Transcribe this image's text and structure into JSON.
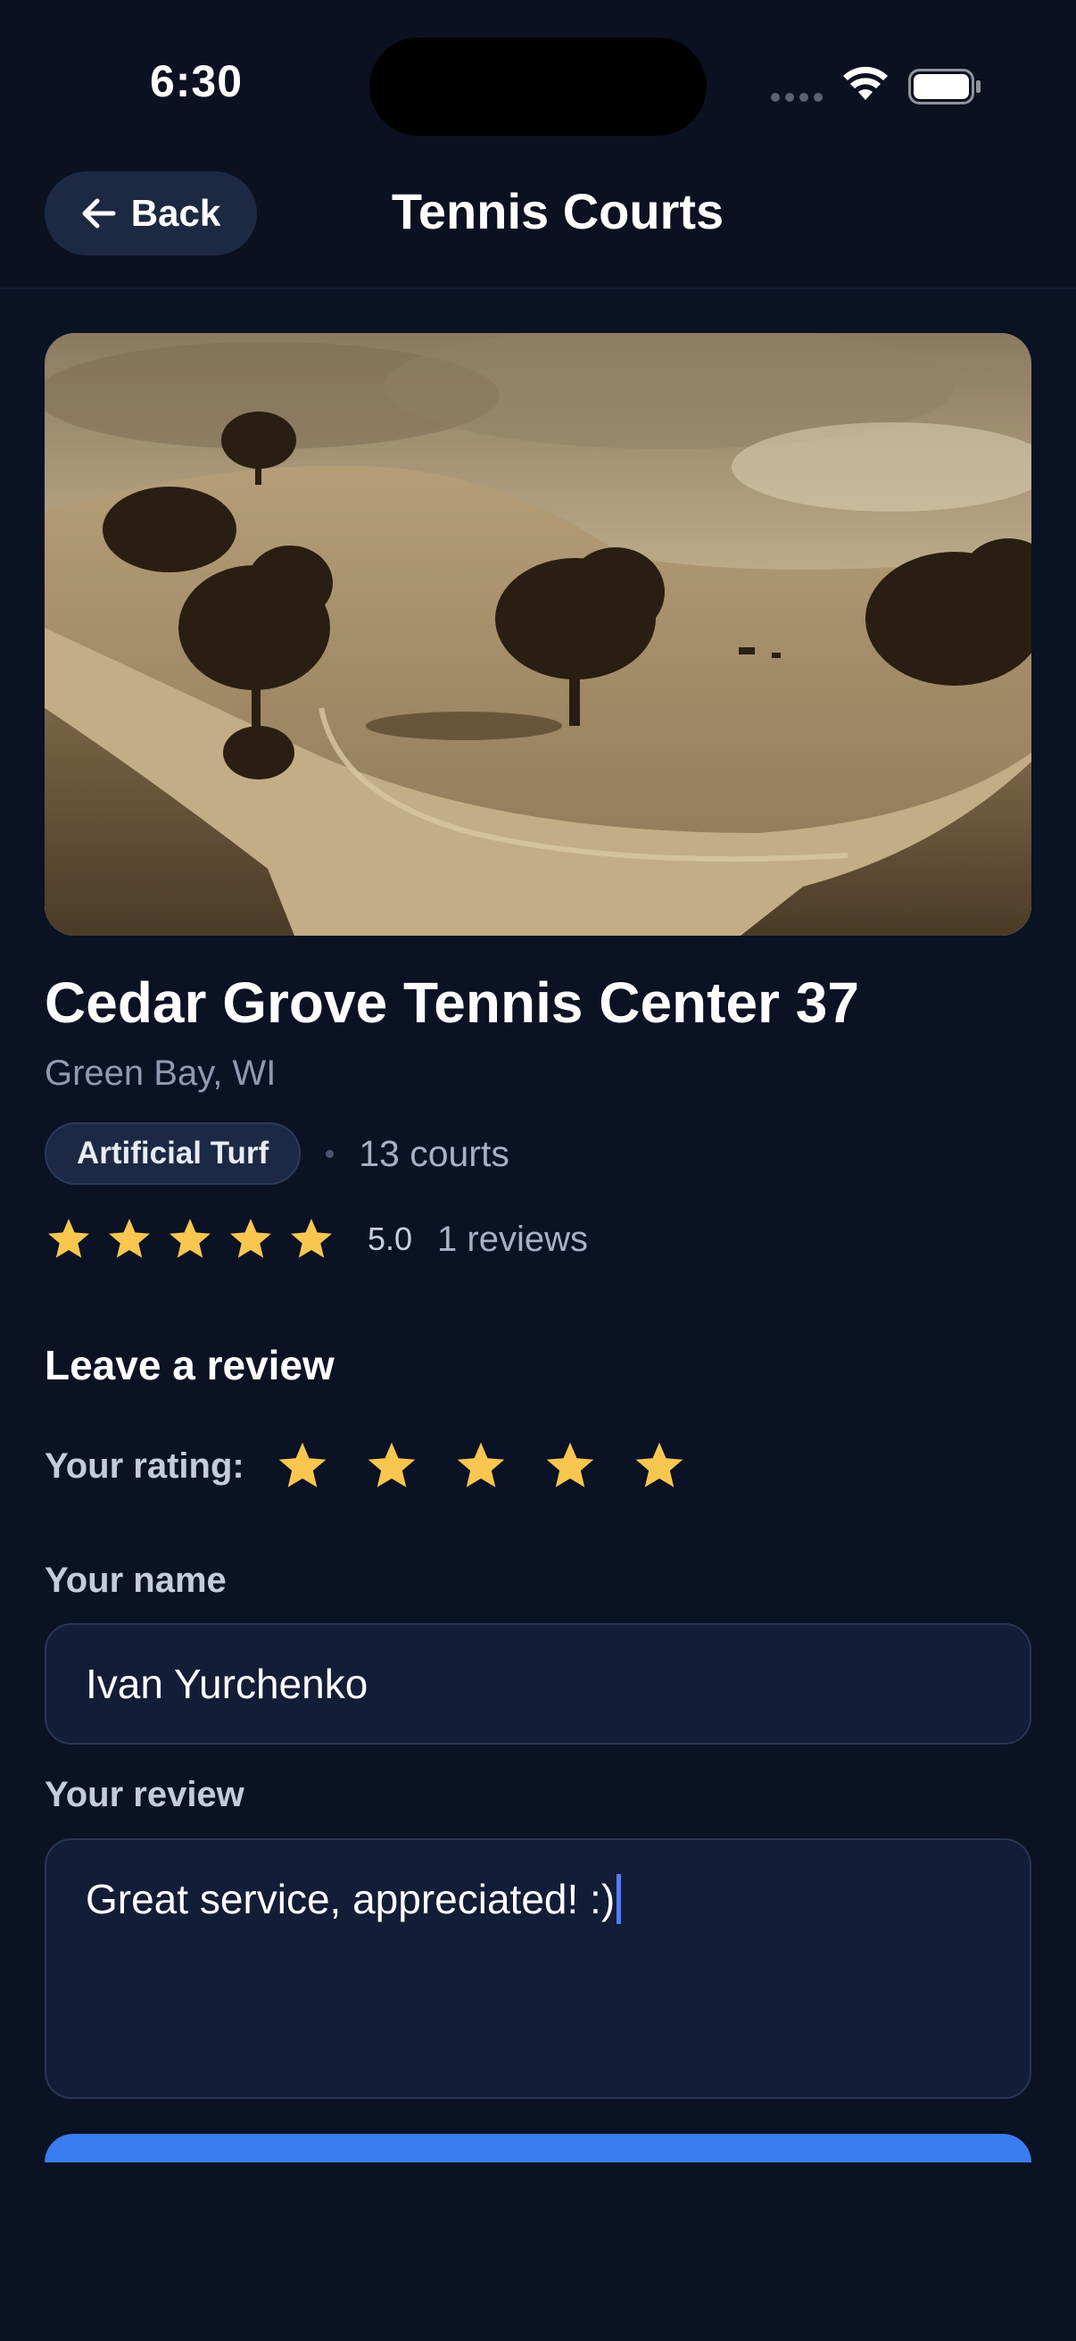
{
  "status_bar": {
    "time": "6:30"
  },
  "nav": {
    "back_label": "Back",
    "title": "Tennis Courts"
  },
  "court": {
    "name": "Cedar Grove Tennis Center 37",
    "location": "Green Bay, WI",
    "surface": "Artificial Turf",
    "courts": "13 courts",
    "rating": "5.0",
    "rating_stars": 5,
    "reviews": "1 reviews"
  },
  "review_form": {
    "section_title": "Leave a review",
    "rating_label": "Your rating:",
    "selected_rating": 5,
    "name_label": "Your name",
    "name_value": "Ivan Yurchenko",
    "review_label": "Your review",
    "review_value": "Great service, appreciated! :)"
  },
  "colors": {
    "background": "#0b1224",
    "star": "#f9c64f",
    "accent": "#3b7cf0",
    "caret": "#4f7dff"
  },
  "icons": {
    "back": "arrow-left-icon",
    "wifi": "wifi-icon",
    "battery": "battery-icon",
    "star": "star-icon"
  }
}
